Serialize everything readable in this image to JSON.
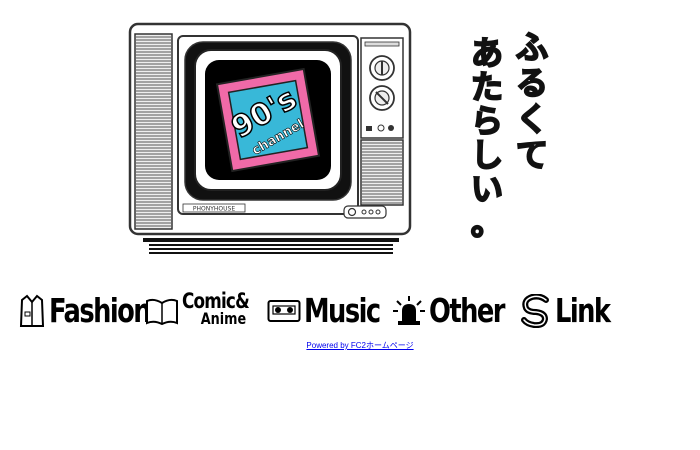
{
  "tv": {
    "screen_logo_top": "90's",
    "screen_logo_bottom": "channel",
    "brand_plate": "PHONYHOUSE"
  },
  "tagline": {
    "column_right": "ふるくて",
    "column_left": "あたらしい。"
  },
  "nav": [
    {
      "label": "Fashion",
      "icon": "shirt-icon"
    },
    {
      "label_line1": "Comic&",
      "label_line2": "Anime",
      "icon": "open-book-icon"
    },
    {
      "label": "Music",
      "icon": "cassette-tape-icon"
    },
    {
      "label": "Other",
      "icon": "siren-light-icon"
    },
    {
      "label": "Link",
      "icon": "s-link-icon"
    }
  ],
  "footer": {
    "powered_by": "Powered by FC2ホームページ"
  }
}
